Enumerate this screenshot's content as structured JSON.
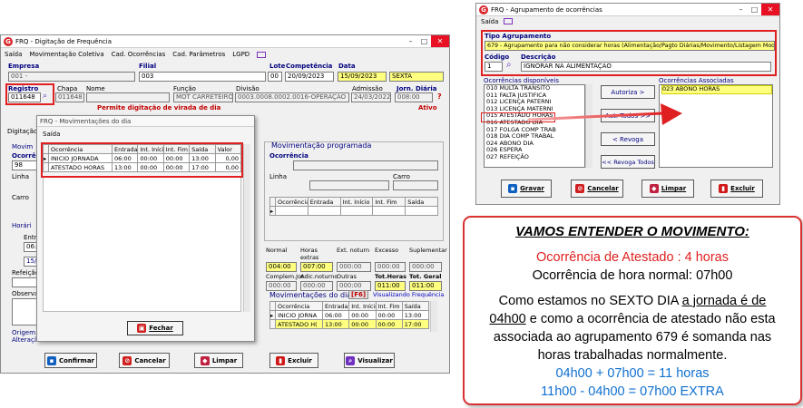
{
  "left": {
    "title": "FRQ - Digitação de Frequência",
    "menu": [
      "Saída",
      "Movimentação Coletiva",
      "Cad. Ocorrências",
      "Cad. Parâmetros",
      "LGPD"
    ],
    "labels": {
      "empresa": "Empresa",
      "filial": "Filial",
      "lote": "Lote",
      "competencia": "Competência",
      "data": "Data",
      "registro": "Registro",
      "chapa": "Chapa",
      "nome": "Nome",
      "funcao": "Função",
      "divisao": "Divisão",
      "admissao": "Admissão",
      "jornada": "Jorn. Diária",
      "digitacao": "Digitação",
      "movim": "Movim",
      "ocorr": "Ocorrê",
      "linha": "Linha",
      "carro": "Carro",
      "horario": "Horári",
      "entra": "Entra",
      "refeicao": "Refeição",
      "observacao": "Observaç",
      "origem": "Origem: D",
      "alteracao": "Alteraçã"
    },
    "values": {
      "empresa": "001 -",
      "filial": "003",
      "lote": "00",
      "competencia": "20/09/2023",
      "data": "15/09/2023",
      "dia": "SEXTA",
      "registro": "011648",
      "chapa": "011648 -",
      "funcao": "MOT CARRETEIRO",
      "divisao": "0003.0008.0002.0016-OPERAÇÃO",
      "admissao": "24/03/2022",
      "jornada": "008:00",
      "ocorr_val": "98",
      "entra_val": "06:0",
      "entra_val2": "15/0"
    },
    "warning": "Permite digitação de virada de dia",
    "status": "Ativo",
    "prog": {
      "title": "Movimentação programada",
      "labels": {
        "ocorrencia": "Ocorrência",
        "linha": "Linha",
        "carro": "Carro"
      },
      "cols": [
        "Ocorrência",
        "Entrada",
        "Int. Início",
        "Int. Fim",
        "Saída"
      ]
    },
    "totals": {
      "row1_labels": [
        "Normal",
        "Horas extras",
        "Ext. noturn",
        "Excesso",
        "Suplementar"
      ],
      "row1_values": [
        "004:00",
        "007:00",
        "000:00",
        "000:00",
        "000:00"
      ],
      "row2_labels": [
        "Complem.Jor.",
        "Adic.noturno",
        "Outras",
        "Tot.Horas",
        "Tot. Geral"
      ],
      "row2_values": [
        "000:00",
        "000:00",
        "000:00",
        "011:00",
        "011:00"
      ]
    },
    "mov_dia": {
      "title": "Movimentações do dia",
      "key": "[F6]",
      "link": "Visualizando Frequência",
      "cols": [
        "Ocorrência",
        "Entrada",
        "Int. Início",
        "Int. Fim",
        "Saída"
      ],
      "rows": [
        [
          "INICIO JORNA",
          "06:00",
          "00:00",
          "00:00",
          "13:00"
        ],
        [
          "ATESTADO H(",
          "13:00",
          "00:00",
          "00:00",
          "17:00"
        ]
      ]
    },
    "buttons": [
      "Confirmar",
      "Cancelar",
      "Limpar",
      "Excluir",
      "Visualizar"
    ]
  },
  "dialog": {
    "title": "FRQ - Movimentações do dia",
    "menu": "Saída",
    "cols": [
      "Ocorrência",
      "Entrada",
      "Int. Início",
      "Int. Fim",
      "Saída",
      "Valor"
    ],
    "rows": [
      [
        "INICIO JORNADA",
        "06:00",
        "00:00",
        "00:00",
        "13:00",
        "0,00"
      ],
      [
        "ATESTADO HORAS",
        "13:00",
        "00:00",
        "00:00",
        "17:00",
        "0,00"
      ]
    ],
    "close": "Fechar"
  },
  "right": {
    "title": "FRQ - Agrupamento de ocorrências",
    "menu": "Saída",
    "tipo_label": "Tipo Agrupamento",
    "tipo_value": "679 - Agrupamento para não considerar horas (Alimentação/Pagto Diárias/Movimento/Listagem Mod. 90)",
    "codigo_label": "Código",
    "codigo_value": "1",
    "descricao_label": "Descrição",
    "descricao_value": "IGNORAR NA ALIMENTAÇÃO",
    "disp_label": "Ocorrências disponíveis",
    "disp_items": [
      "010 MULTA TRANSITO",
      "011 FALTA JUSTIFICA",
      "012 LICENÇA PATERNI",
      "013 LICENÇA MATERNI",
      "015 ATESTADO HORAS",
      "016 ATESTADO DIA",
      "017 FOLGA COMP TRAB",
      "018 DIA COMP TRABAL",
      "024 ABONO DIA",
      "026 ESPERA",
      "027 REFEIÇÃO"
    ],
    "assoc_label": "Ocorrências Associadas",
    "assoc_items": [
      "023 ABONO HORAS"
    ],
    "mid_buttons": [
      "Autoriza >",
      "Aut. Todos >>",
      "< Revoga",
      "<< Revoga Todos"
    ],
    "buttons": [
      "Gravar",
      "Cancelar",
      "Limpar",
      "Excluir"
    ]
  },
  "info": {
    "title": "VAMOS ENTENDER O MOVIMENTO:",
    "line1": "Ocorrência de Atestado : 4 horas",
    "line2": "Ocorrência de hora normal: 07h00",
    "p1a": "Como estamos no SEXTO DIA ",
    "p1b": "a jornada é de",
    "p2a": "04h00",
    "p2b": " e como a ocorrência de atestado não esta",
    "p3": "associada ao agrupamento 679 é somanda nas",
    "p4": "horas trabalhadas normalmente.",
    "calc1": "04h00 + 07h00 = 11 horas",
    "calc2": "11h00 - 04h00 = 07h00 EXTRA"
  }
}
